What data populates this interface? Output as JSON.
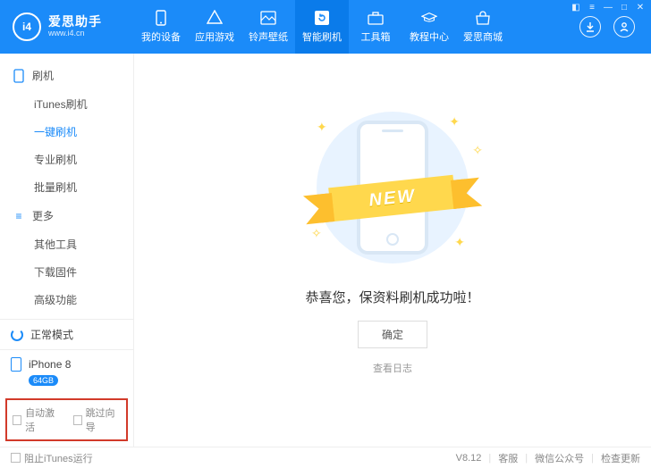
{
  "brand": {
    "logo_text": "i4",
    "title": "爱思助手",
    "url": "www.i4.cn"
  },
  "nav": [
    {
      "label": "我的设备"
    },
    {
      "label": "应用游戏"
    },
    {
      "label": "铃声壁纸"
    },
    {
      "label": "智能刷机"
    },
    {
      "label": "工具箱"
    },
    {
      "label": "教程中心"
    },
    {
      "label": "爱思商城"
    }
  ],
  "active_nav_index": 3,
  "sidebar": {
    "cat1": {
      "label": "刷机",
      "items": [
        "iTunes刷机",
        "一键刷机",
        "专业刷机",
        "批量刷机"
      ],
      "active_index": 1
    },
    "cat2": {
      "label": "更多",
      "items": [
        "其他工具",
        "下载固件",
        "高级功能"
      ]
    }
  },
  "status": {
    "mode": "正常模式"
  },
  "device": {
    "name": "iPhone 8",
    "storage": "64GB"
  },
  "options": {
    "auto_activate": "自动激活",
    "skip_guide": "跳过向导"
  },
  "main": {
    "ribbon": "NEW",
    "message": "恭喜您，保资料刷机成功啦！",
    "ok": "确定",
    "view_log": "查看日志"
  },
  "footer": {
    "block_itunes": "阻止iTunes运行",
    "version": "V8.12",
    "support": "客服",
    "wechat": "微信公众号",
    "check_update": "检查更新"
  }
}
